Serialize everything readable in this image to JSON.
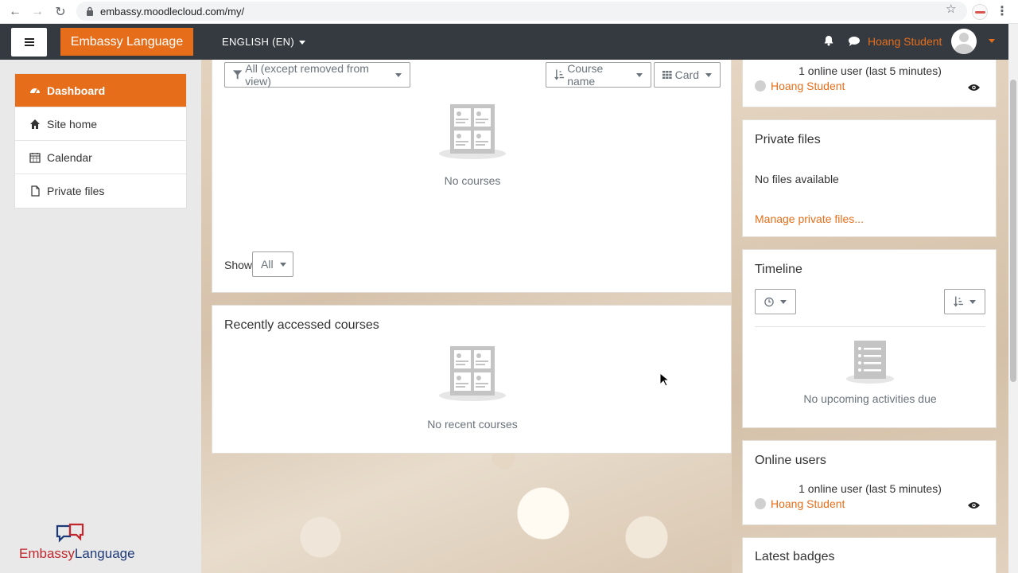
{
  "browser": {
    "url": "embassy.moodlecloud.com/my/"
  },
  "navbar": {
    "brand": "Embassy Language",
    "language": "ENGLISH (EN)",
    "user_name": "Hoang Student"
  },
  "sidebar": {
    "items": [
      {
        "label": "Dashboard",
        "icon": "dashboard-icon",
        "active": true
      },
      {
        "label": "Site home",
        "icon": "home-icon",
        "active": false
      },
      {
        "label": "Calendar",
        "icon": "calendar-icon",
        "active": false
      },
      {
        "label": "Private files",
        "icon": "file-icon",
        "active": false
      }
    ],
    "logo": {
      "part1": "Embassy",
      "part2": "Language"
    }
  },
  "course_overview": {
    "filter_label": "All (except removed from view)",
    "sort_label": "Course name",
    "view_label": "Card",
    "empty_text": "No courses",
    "show_label": "Show",
    "show_value": "All"
  },
  "recent_courses": {
    "title": "Recently accessed courses",
    "empty_text": "No recent courses"
  },
  "online_users_top": {
    "summary": "1 online user (last 5 minutes)",
    "user": "Hoang Student"
  },
  "private_files": {
    "title": "Private files",
    "empty_text": "No files available",
    "manage_link": "Manage private files..."
  },
  "timeline": {
    "title": "Timeline",
    "empty_text": "No upcoming activities due"
  },
  "online_users": {
    "title": "Online users",
    "summary": "1 online user (last 5 minutes)",
    "user": "Hoang Student"
  },
  "latest_badges": {
    "title": "Latest badges"
  },
  "colors": {
    "accent": "#e66e1b",
    "navbar": "#343a40"
  }
}
